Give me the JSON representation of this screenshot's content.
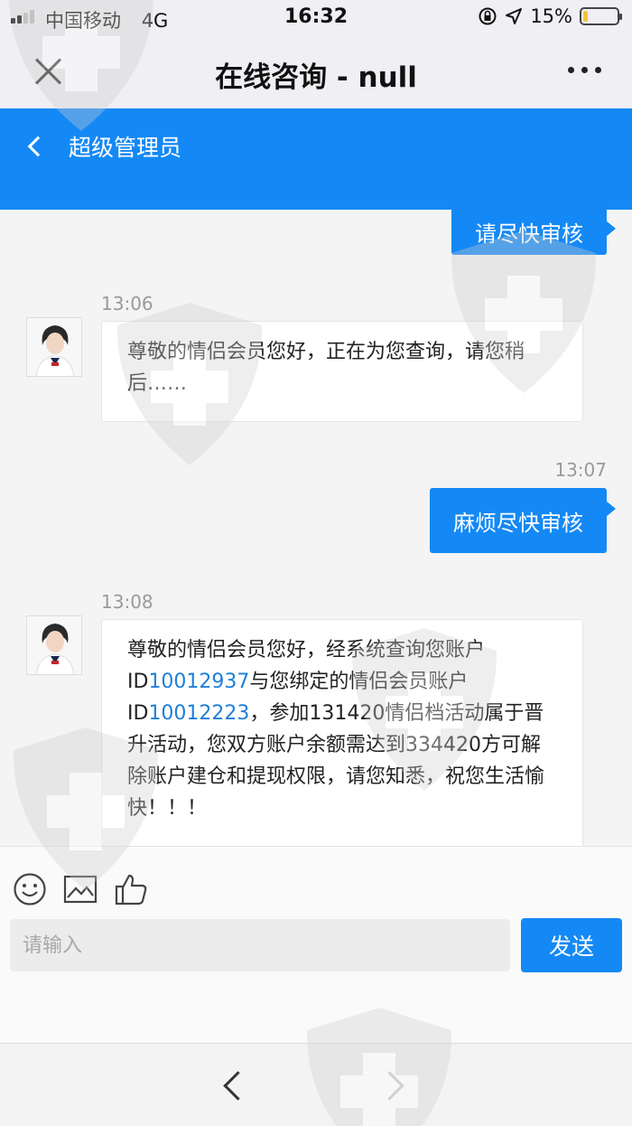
{
  "status_bar": {
    "carrier": "中国移动",
    "network": "4G",
    "time": "16:32",
    "battery_percent": "15%",
    "battery_level": 0.15
  },
  "title_bar": {
    "title": "在线咨询 - null"
  },
  "header": {
    "back_label": "超级管理员"
  },
  "messages": [
    {
      "direction": "outgoing",
      "text": "请尽快审核"
    },
    {
      "direction": "incoming",
      "time": "13:06",
      "text": "尊敬的情侣会员您好，正在为您查询，请您稍后……"
    },
    {
      "direction": "outgoing",
      "time": "13:07",
      "text": "麻烦尽快审核"
    },
    {
      "direction": "incoming",
      "time": "13:08",
      "parts": {
        "p1": "尊敬的情侣会员您好，经系统查询您账户ID",
        "id1": "10012937",
        "p2": "与您绑定的情侣会员账户ID",
        "id2": "10012223",
        "p3": "，参加131420情侣档活动属于晋升活动，您双方账户余额需达到334420方可解除账户建仓和提现权限，请您知悉，祝您生活愉快！！！"
      }
    }
  ],
  "input": {
    "placeholder": "请输入",
    "send_label": "发送"
  },
  "colors": {
    "accent": "#1489f5",
    "link": "#1e7fd8"
  },
  "icons": [
    "close-icon",
    "more-icon",
    "chevron-left-icon",
    "emoji-icon",
    "image-icon",
    "thumbs-up-icon",
    "back-arrow-icon",
    "forward-arrow-icon"
  ]
}
